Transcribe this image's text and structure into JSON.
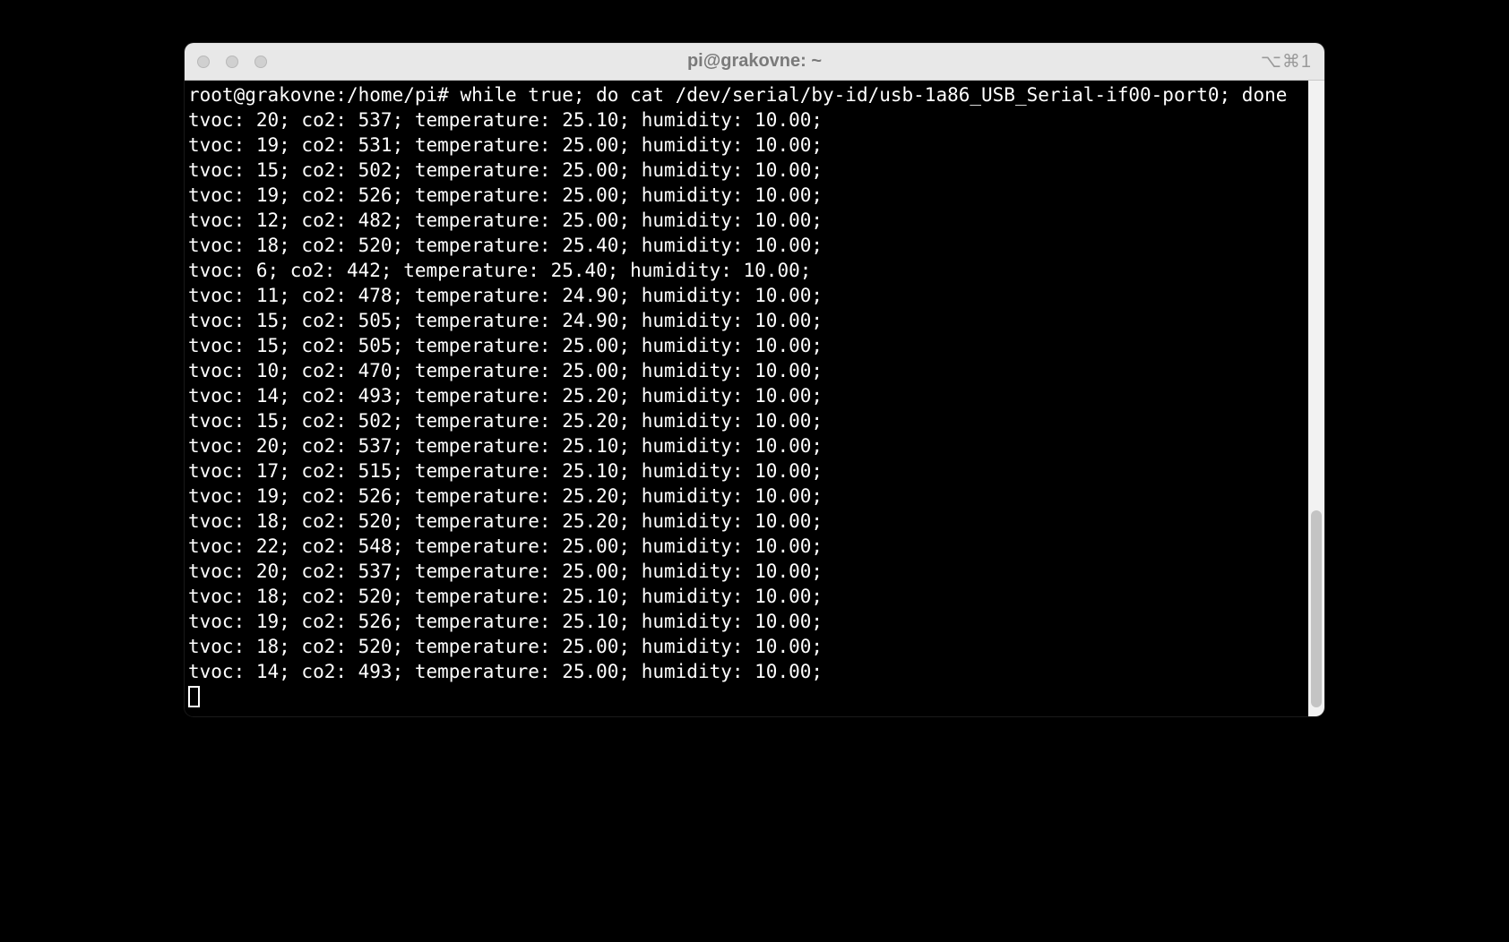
{
  "window": {
    "title": "pi@grakovne: ~",
    "shortcut": "⌥⌘1"
  },
  "terminal": {
    "prompt": "root@grakovne:/home/pi# ",
    "command": "while true; do cat /dev/serial/by-id/usb-1a86_USB_Serial-if00-port0; done",
    "readings": [
      {
        "tvoc": 20,
        "co2": 537,
        "temperature": "25.10",
        "humidity": "10.00"
      },
      {
        "tvoc": 19,
        "co2": 531,
        "temperature": "25.00",
        "humidity": "10.00"
      },
      {
        "tvoc": 15,
        "co2": 502,
        "temperature": "25.00",
        "humidity": "10.00"
      },
      {
        "tvoc": 19,
        "co2": 526,
        "temperature": "25.00",
        "humidity": "10.00"
      },
      {
        "tvoc": 12,
        "co2": 482,
        "temperature": "25.00",
        "humidity": "10.00"
      },
      {
        "tvoc": 18,
        "co2": 520,
        "temperature": "25.40",
        "humidity": "10.00"
      },
      {
        "tvoc": 6,
        "co2": 442,
        "temperature": "25.40",
        "humidity": "10.00"
      },
      {
        "tvoc": 11,
        "co2": 478,
        "temperature": "24.90",
        "humidity": "10.00"
      },
      {
        "tvoc": 15,
        "co2": 505,
        "temperature": "24.90",
        "humidity": "10.00"
      },
      {
        "tvoc": 15,
        "co2": 505,
        "temperature": "25.00",
        "humidity": "10.00"
      },
      {
        "tvoc": 10,
        "co2": 470,
        "temperature": "25.00",
        "humidity": "10.00"
      },
      {
        "tvoc": 14,
        "co2": 493,
        "temperature": "25.20",
        "humidity": "10.00"
      },
      {
        "tvoc": 15,
        "co2": 502,
        "temperature": "25.20",
        "humidity": "10.00"
      },
      {
        "tvoc": 20,
        "co2": 537,
        "temperature": "25.10",
        "humidity": "10.00"
      },
      {
        "tvoc": 17,
        "co2": 515,
        "temperature": "25.10",
        "humidity": "10.00"
      },
      {
        "tvoc": 19,
        "co2": 526,
        "temperature": "25.20",
        "humidity": "10.00"
      },
      {
        "tvoc": 18,
        "co2": 520,
        "temperature": "25.20",
        "humidity": "10.00"
      },
      {
        "tvoc": 22,
        "co2": 548,
        "temperature": "25.00",
        "humidity": "10.00"
      },
      {
        "tvoc": 20,
        "co2": 537,
        "temperature": "25.00",
        "humidity": "10.00"
      },
      {
        "tvoc": 18,
        "co2": 520,
        "temperature": "25.10",
        "humidity": "10.00"
      },
      {
        "tvoc": 19,
        "co2": 526,
        "temperature": "25.10",
        "humidity": "10.00"
      },
      {
        "tvoc": 18,
        "co2": 520,
        "temperature": "25.00",
        "humidity": "10.00"
      },
      {
        "tvoc": 14,
        "co2": 493,
        "temperature": "25.00",
        "humidity": "10.00"
      }
    ]
  }
}
